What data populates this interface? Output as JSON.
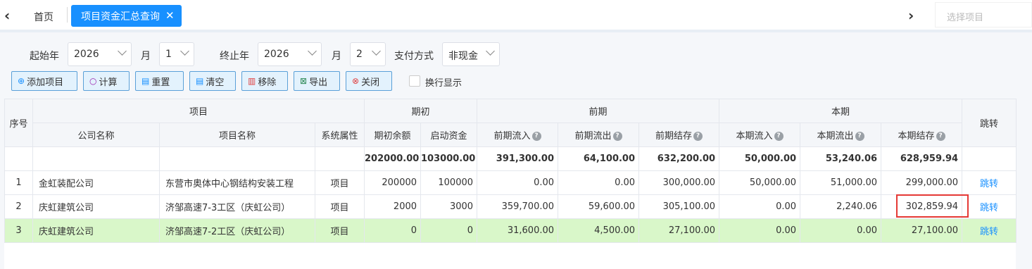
{
  "tabs": {
    "home": "首页",
    "active": "项目资金汇总查询",
    "close_glyph": "✕",
    "project_placeholder": "选择项目"
  },
  "filters": {
    "start_year_label": "起始年",
    "start_year": "2026",
    "month_label": "月",
    "start_month": "1",
    "end_year_label": "终止年",
    "end_year": "2026",
    "end_month_label": "月",
    "end_month": "2",
    "pay_method_label": "支付方式",
    "pay_method": "非现金"
  },
  "toolbar": {
    "add": "添加项目",
    "calc": "计算",
    "reset": "重置",
    "clear": "清空",
    "remove": "移除",
    "export": "导出",
    "close": "关闭",
    "wrap_label": "换行显示"
  },
  "table": {
    "headers": {
      "seq": "序号",
      "project_group": "项目",
      "opening_group": "期初",
      "prior_group": "前期",
      "current_group": "本期",
      "jump": "跳转",
      "company": "公司名称",
      "project_name": "项目名称",
      "attr": "系统属性",
      "opening_balance": "期初余额",
      "start_fund": "启动资金",
      "prior_in": "前期流入",
      "prior_out": "前期流出",
      "prior_stock": "前期结存",
      "cur_in": "本期流入",
      "cur_out": "本期流出",
      "cur_stock": "本期结存"
    },
    "totals": {
      "opening_balance": "202000.00",
      "start_fund": "103000.00",
      "prior_in": "391,300.00",
      "prior_out": "64,100.00",
      "prior_stock": "632,200.00",
      "cur_in": "50,000.00",
      "cur_out": "53,240.06",
      "cur_stock": "628,959.94"
    },
    "rows": [
      {
        "seq": "1",
        "company": "金虹装配公司",
        "project": "东营市奥体中心钢结构安装工程",
        "attr": "项目",
        "opening_balance": "200000",
        "start_fund": "100000",
        "prior_in": "0.00",
        "prior_out": "0.00",
        "prior_stock": "300,000.00",
        "cur_in": "50,000.00",
        "cur_out": "51,000.00",
        "cur_stock": "299,000.00",
        "jump": "跳转"
      },
      {
        "seq": "2",
        "company": "庆虹建筑公司",
        "project": "济邹高速7-3工区（庆虹公司）",
        "attr": "项目",
        "opening_balance": "2000",
        "start_fund": "3000",
        "prior_in": "359,700.00",
        "prior_out": "59,600.00",
        "prior_stock": "305,100.00",
        "cur_in": "0.00",
        "cur_out": "2,240.06",
        "cur_stock": "302,859.94",
        "jump": "跳转"
      },
      {
        "seq": "3",
        "company": "庆虹建筑公司",
        "project": "济邹高速7-2工区（庆虹公司）",
        "attr": "项目",
        "opening_balance": "0",
        "start_fund": "0",
        "prior_in": "31,600.00",
        "prior_out": "4,500.00",
        "prior_stock": "27,100.00",
        "cur_in": "0.00",
        "cur_out": "0.00",
        "cur_stock": "27,100.00",
        "jump": "跳转"
      }
    ]
  },
  "colors": {
    "accent": "#1890ff",
    "highlight_row": "#d9f7c9",
    "annotation_box": "#e53935"
  }
}
